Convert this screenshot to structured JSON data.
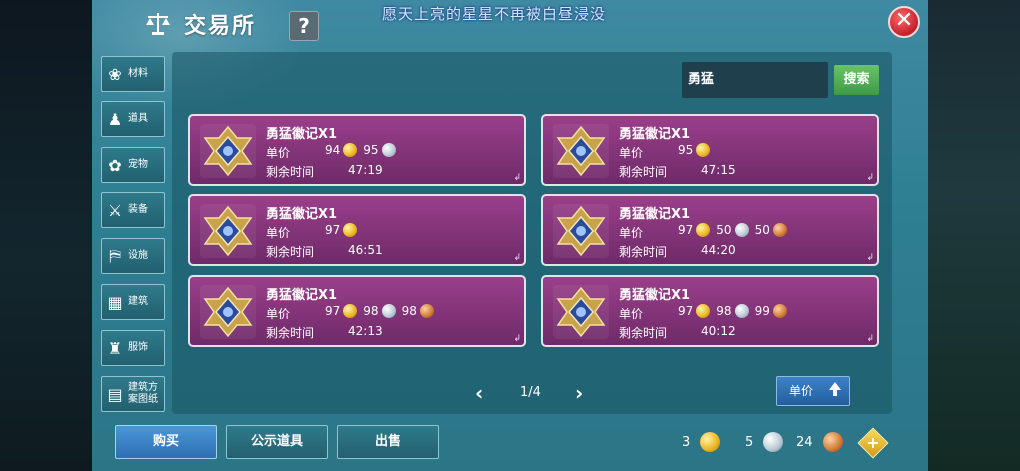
{
  "window": {
    "title": "交易所",
    "help_label": "?",
    "banner_text": "愿天上亮的星星不再被白昼浸没",
    "close_label": "✕"
  },
  "categories": [
    {
      "label": "材料",
      "icon": "materials-icon"
    },
    {
      "label": "道具",
      "icon": "props-icon"
    },
    {
      "label": "宠物",
      "icon": "paw-icon"
    },
    {
      "label": "装备",
      "icon": "equipment-icon"
    },
    {
      "label": "设施",
      "icon": "facility-icon"
    },
    {
      "label": "建筑",
      "icon": "building-icon"
    },
    {
      "label": "服饰",
      "icon": "clothing-icon"
    },
    {
      "label": "建筑方案图纸",
      "icon": "blueprint-icon"
    }
  ],
  "search": {
    "value": "勇猛",
    "button_label": "搜索"
  },
  "listings": [
    {
      "name": "勇猛徽记X1",
      "price_label": "单价",
      "time_label": "剩余时间",
      "time": "47:19",
      "prices": [
        {
          "value": "94",
          "coin": "gold"
        },
        {
          "value": "95",
          "coin": "silver"
        }
      ]
    },
    {
      "name": "勇猛徽记X1",
      "price_label": "单价",
      "time_label": "剩余时间",
      "time": "47:15",
      "prices": [
        {
          "value": "95",
          "coin": "gold"
        }
      ]
    },
    {
      "name": "勇猛徽记X1",
      "price_label": "单价",
      "time_label": "剩余时间",
      "time": "46:51",
      "prices": [
        {
          "value": "97",
          "coin": "gold"
        }
      ]
    },
    {
      "name": "勇猛徽记X1",
      "price_label": "单价",
      "time_label": "剩余时间",
      "time": "44:20",
      "prices": [
        {
          "value": "97",
          "coin": "gold"
        },
        {
          "value": "50",
          "coin": "silver"
        },
        {
          "value": "50",
          "coin": "bronze"
        }
      ]
    },
    {
      "name": "勇猛徽记X1",
      "price_label": "单价",
      "time_label": "剩余时间",
      "time": "42:13",
      "prices": [
        {
          "value": "97",
          "coin": "gold"
        },
        {
          "value": "98",
          "coin": "silver"
        },
        {
          "value": "98",
          "coin": "bronze"
        }
      ]
    },
    {
      "name": "勇猛徽记X1",
      "price_label": "单价",
      "time_label": "剩余时间",
      "time": "40:12",
      "prices": [
        {
          "value": "97",
          "coin": "gold"
        },
        {
          "value": "98",
          "coin": "silver"
        },
        {
          "value": "99",
          "coin": "bronze"
        }
      ]
    }
  ],
  "pager": {
    "text": "1/4",
    "prev": "‹",
    "next": "›"
  },
  "sort": {
    "label": "单价"
  },
  "tabs": [
    {
      "label": "购买",
      "active": true
    },
    {
      "label": "公示道具",
      "active": false
    },
    {
      "label": "出售",
      "active": false
    }
  ],
  "wallet": [
    {
      "value": "3",
      "coin": "gold"
    },
    {
      "value": "5",
      "coin": "silver"
    },
    {
      "value": "24",
      "coin": "bronze"
    }
  ],
  "colors": {
    "card_top": "#9b3f8a",
    "card_bottom": "#6e2a69",
    "window_bg": "#2e7f92",
    "search_btn": "#4fae52",
    "close_btn": "#c41f2a"
  }
}
